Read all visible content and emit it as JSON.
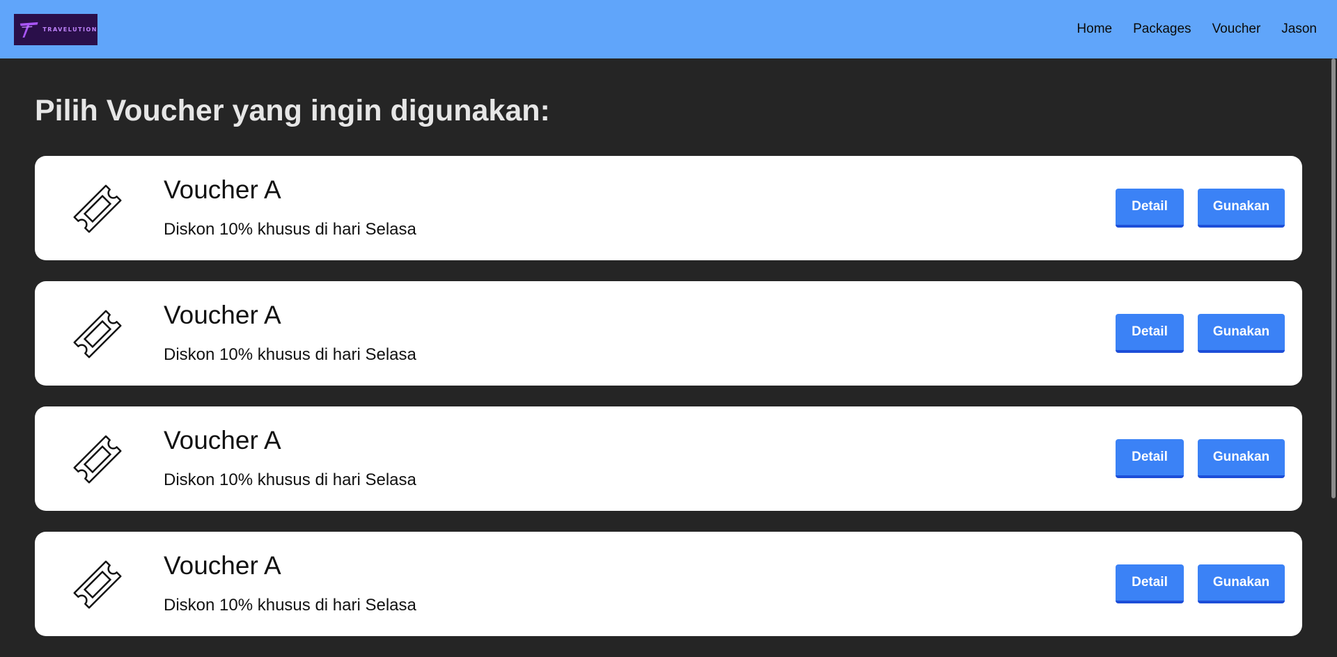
{
  "brand": {
    "logo_text": "TRAVELUTION",
    "logo_color": "#c084fc",
    "logo_bg": "#2a0f4a"
  },
  "nav": {
    "items": [
      {
        "label": "Home"
      },
      {
        "label": "Packages"
      },
      {
        "label": "Voucher"
      },
      {
        "label": "Jason"
      }
    ]
  },
  "page": {
    "title": "Pilih Voucher yang ingin digunakan:"
  },
  "vouchers": [
    {
      "title": "Voucher A",
      "description": "Diskon 10% khusus di hari Selasa",
      "detail_label": "Detail",
      "use_label": "Gunakan",
      "icon": "ticket-icon"
    },
    {
      "title": "Voucher A",
      "description": "Diskon 10% khusus di hari Selasa",
      "detail_label": "Detail",
      "use_label": "Gunakan",
      "icon": "ticket-icon"
    },
    {
      "title": "Voucher A",
      "description": "Diskon 10% khusus di hari Selasa",
      "detail_label": "Detail",
      "use_label": "Gunakan",
      "icon": "ticket-icon"
    },
    {
      "title": "Voucher A",
      "description": "Diskon 10% khusus di hari Selasa",
      "detail_label": "Detail",
      "use_label": "Gunakan",
      "icon": "ticket-icon"
    }
  ],
  "colors": {
    "navbar": "#60a5fa",
    "background": "#252525",
    "button": "#3b82f6",
    "button_border": "#1d4ed8",
    "card": "#ffffff"
  }
}
